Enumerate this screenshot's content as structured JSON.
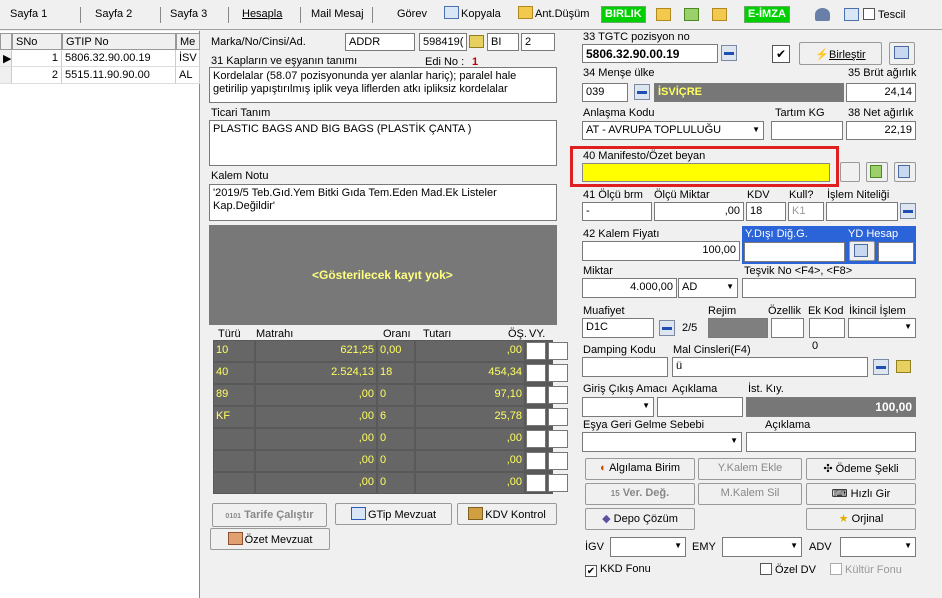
{
  "toolbar": {
    "sayfa1": "Sayfa 1",
    "sayfa2": "Sayfa 2",
    "sayfa3": "Sayfa 3",
    "hesapla": "Hesapla",
    "mail": "Mail Mesaj",
    "gorev": "Görev",
    "kopyala": "Kopyala",
    "antdusum": "Ant.Düşüm",
    "birlik": "BIRLIK",
    "eimza": "E-İMZA",
    "tescil": "Tescil"
  },
  "grid": {
    "headers": [
      "SNo",
      "GTIP No",
      "Me"
    ],
    "rows": [
      {
        "sno": "1",
        "gtip": "5806.32.90.00.19",
        "me": "İSV"
      },
      {
        "sno": "2",
        "gtip": "5515.11.90.90.00",
        "me": "AL"
      }
    ]
  },
  "form": {
    "marka_label": "Marka/No/Cinsi/Ad.",
    "marka_val": "ADDR",
    "marka_num": "598419(",
    "bi_val": "BI",
    "bi_num": "2",
    "kap_label": "31 Kapların ve eşyanın tanımı",
    "edino_label": "Edi No :",
    "edino_val": "1",
    "kap_text": "Kordelalar (58.07 pozisyonunda yer alanlar hariç); paralel hale getirilip yapıştırılmış iplik veya liflerden atkı ipliksiz kordelalar",
    "ticari_label": "Ticari Tanım",
    "ticari_text": "PLASTIC BAGS AND BIG BAGS  (PLASTİK ÇANTA )",
    "kalem_label": "Kalem Notu",
    "kalem_text": "'2019/5 Teb.Gıd.Yem Bitki Gıda Tem.Eden Mad.Ek Listeler Kap.Değildir'",
    "no_record": "<Gösterilecek kayıt yok>",
    "tax_headers": {
      "turu": "Türü",
      "matrahi": "Matrahı",
      "orani": "Oranı",
      "tutari": "Tutarı",
      "os": "ÖŞ.",
      "vy": "VY."
    },
    "tax_rows": [
      {
        "t": "10",
        "m": "621,25",
        "o": "0,00",
        "u": ",00"
      },
      {
        "t": "40",
        "m": "2.524,13",
        "o": "18",
        "u": "454,34"
      },
      {
        "t": "89",
        "m": ",00",
        "o": "0",
        "u": "97,10"
      },
      {
        "t": "KF",
        "m": ",00",
        "o": "6",
        "u": "25,78"
      },
      {
        "t": "",
        "m": ",00",
        "o": "0",
        "u": ",00"
      },
      {
        "t": "",
        "m": ",00",
        "o": "0",
        "u": ",00"
      },
      {
        "t": "",
        "m": ",00",
        "o": "0",
        "u": ",00"
      }
    ],
    "tarife_btn": "Tarife Çalıştır",
    "tarife_num": "0101",
    "gtip_btn": "GTip Mevzuat",
    "kdv_btn": "KDV Kontrol",
    "ozet_btn": "Özet Mevzuat",
    "tgtc_label": "33 TGTC pozisyon no",
    "tgtc_val": "5806.32.90.00.19",
    "birlestir": "Birleştir",
    "mense_label": "34 Menşe ülke",
    "mense_code": "039",
    "mense_name": "İSVİÇRE",
    "brut_label": "35 Brüt ağırlık",
    "brut_val": "24,14",
    "anlasma_label": "Anlaşma Kodu",
    "tartim_label": "Tartım KG",
    "net_label": "38 Net ağırlık",
    "anlasma_val": "AT    - AVRUPA TOPLULUĞU",
    "net_val": "22,19",
    "manifesto_label": "40 Manifesto/Özet beyan",
    "olcu_label": "41 Ölçü brm",
    "olcu_miktar_label": "Ölçü Miktar",
    "kdv_label": "KDV",
    "kull_label": "Kull?",
    "islem_label": "İşlem Niteliği",
    "olcu_val": "-",
    "olcu_miktar_val": ",00",
    "kdv_val": "18",
    "kull_val": "K1",
    "kalem_fiyat_label": "42 Kalem Fiyatı",
    "kalem_fiyat_val": "100,00",
    "ydisi_label": "Y.Dışı Diğ.G.",
    "yd_hesap_label": "YD Hesap",
    "miktar_label": "Miktar",
    "miktar_val": "4.000,00",
    "miktar_unit": "AD",
    "tesvik_label": "Teşvik No <F4>, <F8>",
    "muafiyet_label": "Muafiyet",
    "rejim_label": "Rejim",
    "ozellik_label": "Özellik",
    "ek_kod_label": "Ek Kod",
    "ikincil_label": "İkincil İşlem",
    "muafiyet_val": "D1C",
    "rejim_val": "2/5",
    "damping_label": "Damping Kodu",
    "mal_cins_label": "Mal Cinsleri(F4)",
    "zero": "0",
    "mal_cins_val": "ü",
    "giris_label": "Giriş Çıkış Amacı",
    "aciklama_label": "Açıklama",
    "ist_kiy_label": "İst. Kıy.",
    "ist_kiy_val": "100,00",
    "esya_label": "Eşya Geri Gelme Sebebi",
    "aciklama2_label": "Açıklama",
    "algilama": "Algılama Birim",
    "ykalem": "Y.Kalem Ekle",
    "odeme": "Ödeme Şekli",
    "ver_deg": "Ver. Değ.",
    "mkalem": "M.Kalem Sil",
    "hizli": "Hızlı Gir",
    "depo": "Depo Çözüm",
    "orjinal": "Orjinal",
    "igv_label": "İGV",
    "emy_label": "EMY",
    "adv_label": "ADV",
    "kkd_label": "KKD Fonu",
    "ozel_dv": "Özel DV",
    "kultur_fonu": "Kültür Fonu"
  }
}
